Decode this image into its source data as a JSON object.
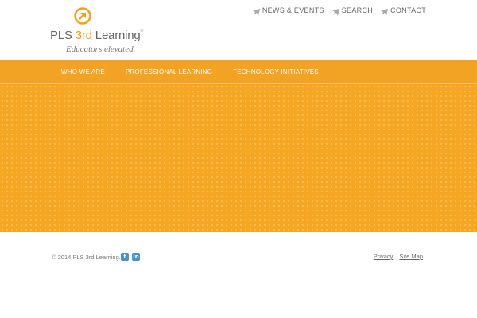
{
  "brand": {
    "name_part1": "PLS ",
    "name_accent": "3rd",
    "name_part2": " Learning",
    "trademark": "®",
    "tagline": "Educators elevated.",
    "accent_color": "#f0a020"
  },
  "utility_nav": [
    {
      "label": "NEWS & EVENTS",
      "icon": "arrow-pointer-icon"
    },
    {
      "label": "SEARCH",
      "icon": "arrow-pointer-icon"
    },
    {
      "label": "CONTACT",
      "icon": "arrow-pointer-icon"
    }
  ],
  "main_nav": [
    {
      "label": "WHO WE ARE"
    },
    {
      "label": "PROFESSIONAL LEARNING"
    },
    {
      "label": "TECHNOLOGY INITIATIVES"
    }
  ],
  "hero": {
    "background_color": "#f5a623"
  },
  "footer": {
    "copyright": "© 2014 PLS 3rd Learning.",
    "social": [
      {
        "name": "twitter-icon",
        "glyph": "t"
      },
      {
        "name": "linkedin-icon",
        "glyph": "in"
      }
    ],
    "links": [
      {
        "label": "Privacy"
      },
      {
        "label": "Site Map"
      }
    ]
  }
}
